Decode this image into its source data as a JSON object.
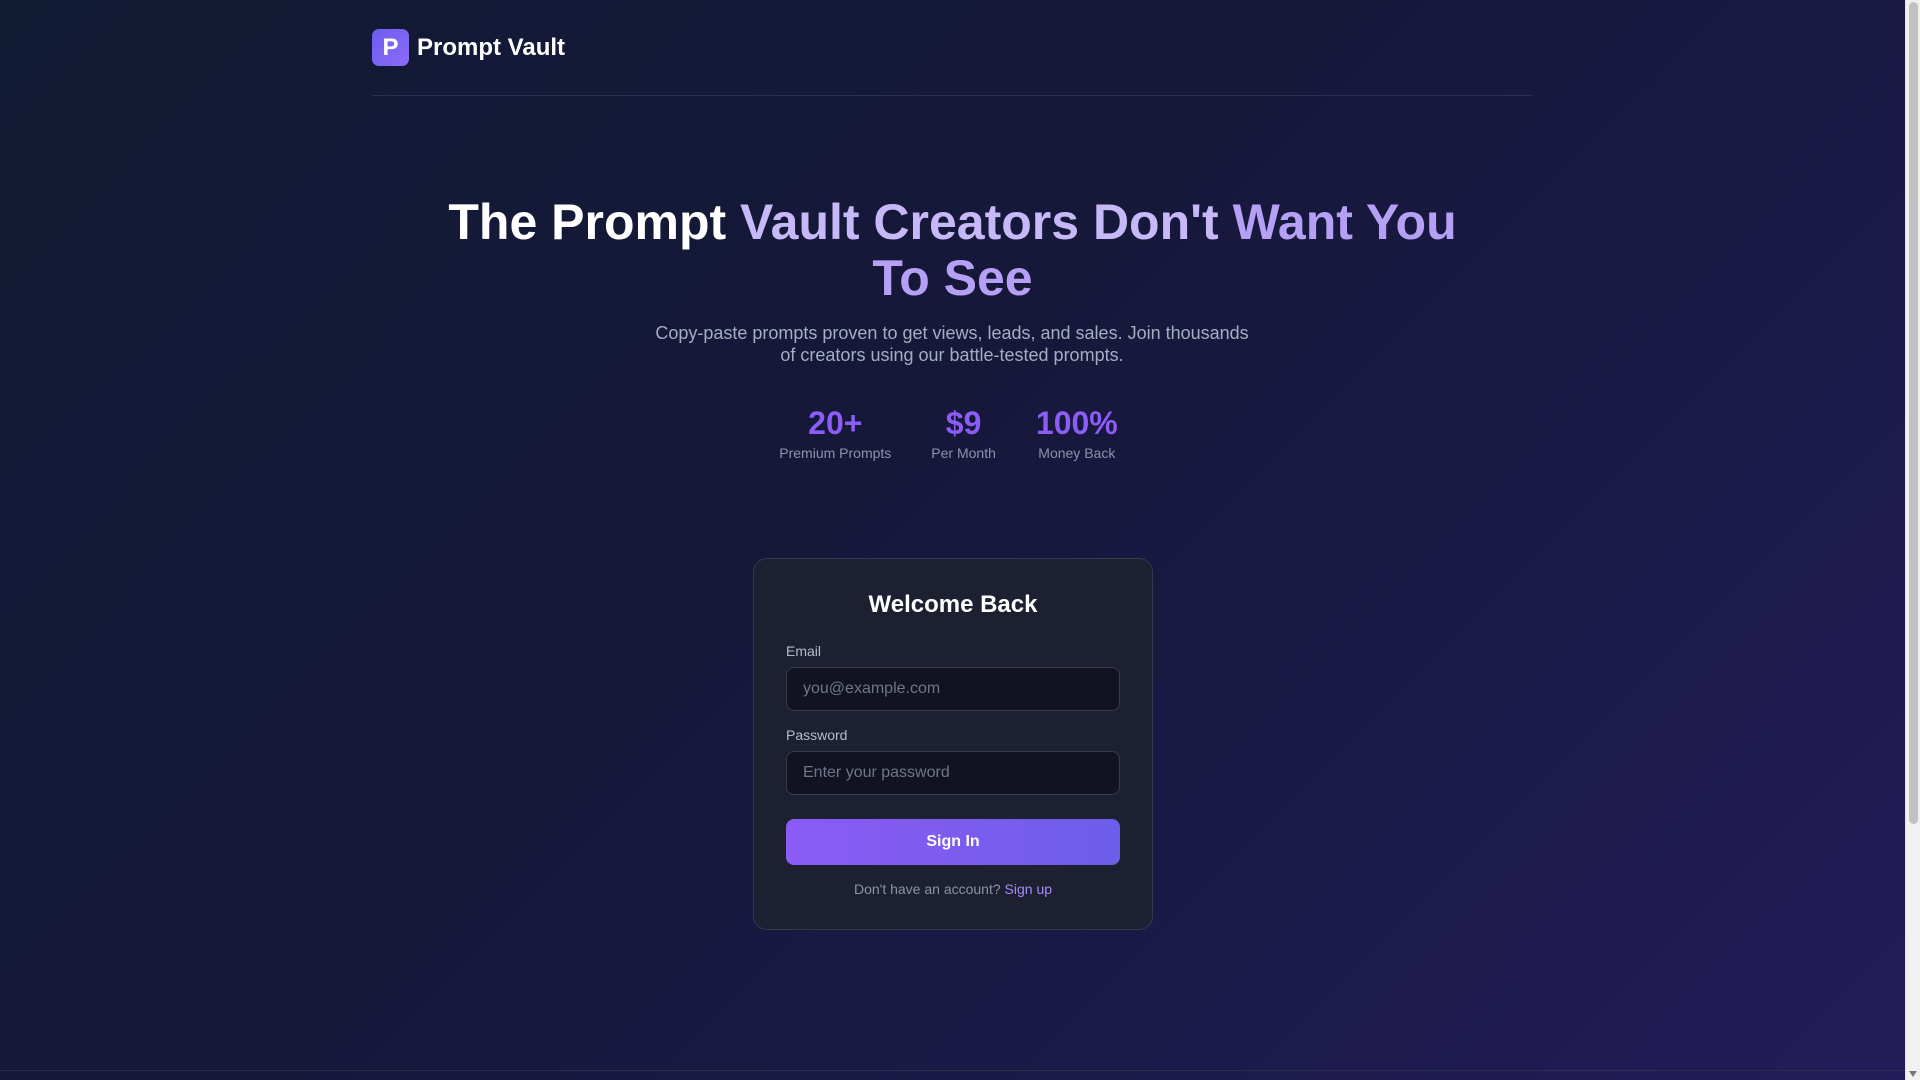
{
  "brand": {
    "badge": "P",
    "name": "Prompt Vault"
  },
  "hero": {
    "title_part1": "The Prompt ",
    "title_part2": "Vault Creators Don't ",
    "title_part3": "Want You To See",
    "subtitle": "Copy-paste prompts proven to get views, leads, and sales. Join thousands of creators using our battle-tested prompts."
  },
  "stats": [
    {
      "value": "20+",
      "label": "Premium Prompts"
    },
    {
      "value": "$9",
      "label": "Per Month"
    },
    {
      "value": "100%",
      "label": "Money Back"
    }
  ],
  "login": {
    "title": "Welcome Back",
    "email_label": "Email",
    "email_placeholder": "you@example.com",
    "email_value": "",
    "password_label": "Password",
    "password_placeholder": "Enter your password",
    "password_value": "",
    "submit_label": "Sign In",
    "signup_prompt": "Don't have an account?",
    "signup_link": "Sign up"
  },
  "colors": {
    "accent": "#8b5cf6",
    "background": "#16183a",
    "card": "#1c2031"
  }
}
